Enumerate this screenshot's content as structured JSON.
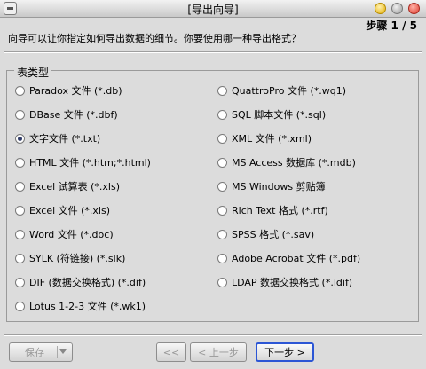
{
  "window": {
    "title": "[导出向导]",
    "step": "步骤 1 / 5"
  },
  "instruction": "向导可以让你指定如何导出数据的细节。你要使用哪一种导出格式？",
  "table_type": {
    "label": "表类型",
    "left": [
      {
        "label": "Paradox 文件 (*.db)",
        "checked": false
      },
      {
        "label": "DBase 文件 (*.dbf)",
        "checked": false
      },
      {
        "label": "文字文件 (*.txt)",
        "checked": true
      },
      {
        "label": "HTML 文件 (*.htm;*.html)",
        "checked": false
      },
      {
        "label": "Excel 试算表 (*.xls)",
        "checked": false
      },
      {
        "label": "Excel 文件 (*.xls)",
        "checked": false
      },
      {
        "label": "Word 文件 (*.doc)",
        "checked": false
      },
      {
        "label": "SYLK (符链接) (*.slk)",
        "checked": false
      },
      {
        "label": "DIF (数据交换格式) (*.dif)",
        "checked": false
      },
      {
        "label": "Lotus 1-2-3 文件 (*.wk1)",
        "checked": false
      }
    ],
    "right": [
      {
        "label": "QuattroPro 文件 (*.wq1)",
        "checked": false
      },
      {
        "label": "SQL 脚本文件 (*.sql)",
        "checked": false
      },
      {
        "label": "XML 文件 (*.xml)",
        "checked": false
      },
      {
        "label": "MS Access 数据库 (*.mdb)",
        "checked": false
      },
      {
        "label": "MS Windows 剪贴簿",
        "checked": false
      },
      {
        "label": "Rich Text 格式 (*.rtf)",
        "checked": false
      },
      {
        "label": "SPSS 格式 (*.sav)",
        "checked": false
      },
      {
        "label": "Adobe Acrobat 文件 (*.pdf)",
        "checked": false
      },
      {
        "label": "LDAP 数据交换格式 (*.ldif)",
        "checked": false
      }
    ]
  },
  "buttons": {
    "save": "保存",
    "first": "<<",
    "prev": "< 上一步",
    "next": "下一步 >"
  }
}
